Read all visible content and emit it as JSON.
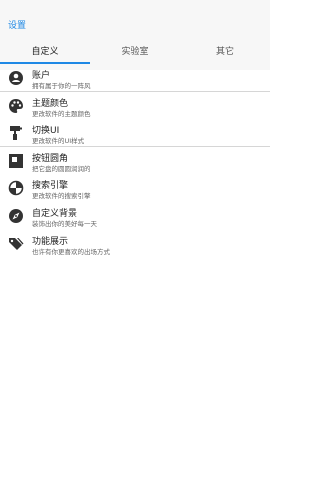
{
  "header": {
    "title": "设置"
  },
  "tabs": [
    {
      "label": "自定义",
      "active": true
    },
    {
      "label": "实验室",
      "active": false
    },
    {
      "label": "其它",
      "active": false
    }
  ],
  "items": [
    {
      "label": "账户",
      "sub": "拥有属于你的一阵风",
      "icon": "account-icon"
    },
    {
      "label": "主题颜色",
      "sub": "更改软件的主题颜色",
      "icon": "palette-icon"
    },
    {
      "label": "切换UI",
      "sub": "更改软件的UI样式",
      "icon": "paint-roller-icon"
    },
    {
      "label": "按钮圆角",
      "sub": "把它盘的圆圆润润的",
      "icon": "rounded-corner-icon"
    },
    {
      "label": "搜索引擎",
      "sub": "更改软件的搜索引擎",
      "icon": "search-engine-icon"
    },
    {
      "label": "自定义背景",
      "sub": "装饰出你的美好每一天",
      "icon": "compass-icon"
    },
    {
      "label": "功能展示",
      "sub": "也许有你更喜欢的出场方式",
      "icon": "tags-icon"
    }
  ],
  "colors": {
    "accent": "#1e88e5",
    "icon": "#333333",
    "header_bg": "#f7f7f7"
  }
}
